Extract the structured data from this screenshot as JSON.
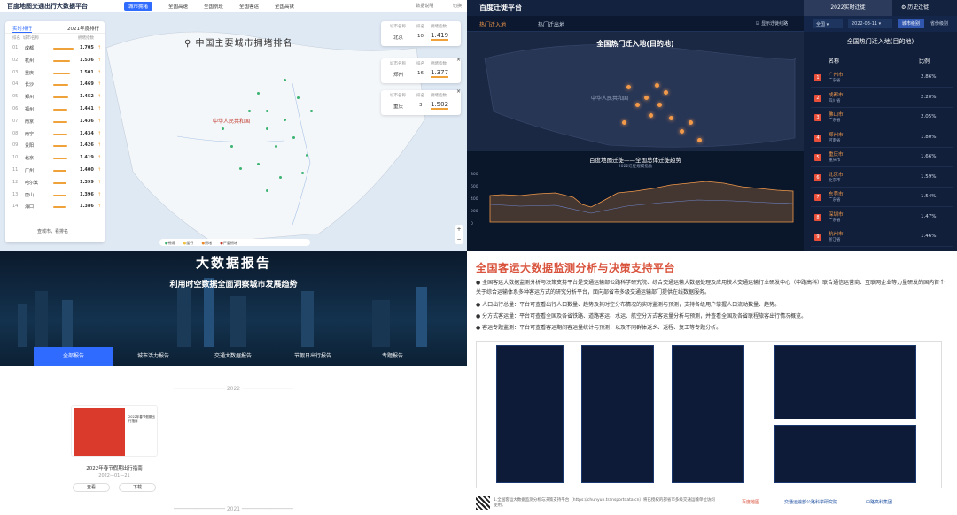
{
  "q1": {
    "logo": "百度地图交通出行大数据平台",
    "nav": [
      "城市拥堵",
      "全国高速",
      "全国航班",
      "全国客运",
      "全国高铁"
    ],
    "top_right": [
      "数据说明",
      "切换"
    ],
    "panel_tabs": [
      "实时排行",
      "2021年度排行"
    ],
    "panel_headers": [
      "排名",
      "城市名称",
      "拥堵指数"
    ],
    "rows": [
      {
        "rank": "01",
        "city": "成都",
        "value": "1.705",
        "pct": 0.95
      },
      {
        "rank": "02",
        "city": "杭州",
        "value": "1.536",
        "pct": 0.8
      },
      {
        "rank": "03",
        "city": "重庆",
        "value": "1.501",
        "pct": 0.77
      },
      {
        "rank": "04",
        "city": "长沙",
        "value": "1.469",
        "pct": 0.72
      },
      {
        "rank": "05",
        "city": "郑州",
        "value": "1.452",
        "pct": 0.7
      },
      {
        "rank": "06",
        "city": "福州",
        "value": "1.441",
        "pct": 0.68
      },
      {
        "rank": "07",
        "city": "南京",
        "value": "1.436",
        "pct": 0.67
      },
      {
        "rank": "08",
        "city": "南宁",
        "value": "1.434",
        "pct": 0.67
      },
      {
        "rank": "09",
        "city": "贵阳",
        "value": "1.426",
        "pct": 0.66
      },
      {
        "rank": "10",
        "city": "北京",
        "value": "1.419",
        "pct": 0.65
      },
      {
        "rank": "11",
        "city": "广州",
        "value": "1.400",
        "pct": 0.62
      },
      {
        "rank": "12",
        "city": "哈尔滨",
        "value": "1.399",
        "pct": 0.62
      },
      {
        "rank": "13",
        "city": "唐山",
        "value": "1.396",
        "pct": 0.61
      },
      {
        "rank": "14",
        "city": "海口",
        "value": "1.386",
        "pct": 0.6
      }
    ],
    "panel_footer": "查城市，看排名",
    "map_title": "中国主要城市拥堵排名",
    "map_label": "中华人民共和国",
    "compare": [
      {
        "h1": "城市名称",
        "h2": "排名",
        "h3": "拥堵指数",
        "city": "北京",
        "rank": "10",
        "value": "1.419"
      },
      {
        "h1": "城市名称",
        "h2": "排名",
        "h3": "拥堵指数",
        "city": "郑州",
        "rank": "16",
        "value": "1.377"
      },
      {
        "h1": "城市名称",
        "h2": "排名",
        "h3": "拥堵指数",
        "city": "重庆",
        "rank": "3",
        "value": "1.502"
      }
    ],
    "legend": [
      "畅通",
      "缓行",
      "拥堵",
      "严重拥堵"
    ]
  },
  "q2": {
    "logo": "百度迁徙平台",
    "tabs": [
      "热门迁入地",
      "热门迁出地"
    ],
    "checkbox": "显示迁徙线路",
    "header_btn": "2022实时迁徙",
    "history": "历史迁徙",
    "sel_region": "全国",
    "sel_date": "2022-03-11",
    "btn_city": "城市级别",
    "btn_prov": "省份级别",
    "map_title": "全国热门迁入地(目的地)",
    "map_label": "中华人民共和国",
    "chart_title": "百度地图迁徙——全国总体迁徙趋势",
    "chart_sub": "2022迁徙规模指数",
    "panel_title": "全国热门迁入地(目的地)",
    "col_name": "名称",
    "col_ratio": "比例",
    "rows": [
      {
        "n": "1",
        "city": "广州市",
        "prov": "广东省",
        "ratio": "2.86%"
      },
      {
        "n": "2",
        "city": "成都市",
        "prov": "四川省",
        "ratio": "2.20%"
      },
      {
        "n": "3",
        "city": "佛山市",
        "prov": "广东省",
        "ratio": "2.05%"
      },
      {
        "n": "4",
        "city": "郑州市",
        "prov": "河南省",
        "ratio": "1.80%"
      },
      {
        "n": "5",
        "city": "重庆市",
        "prov": "重庆市",
        "ratio": "1.66%"
      },
      {
        "n": "6",
        "city": "北京市",
        "prov": "北京市",
        "ratio": "1.59%"
      },
      {
        "n": "7",
        "city": "东莞市",
        "prov": "广东省",
        "ratio": "1.54%"
      },
      {
        "n": "8",
        "city": "深圳市",
        "prov": "广东省",
        "ratio": "1.47%"
      },
      {
        "n": "9",
        "city": "杭州市",
        "prov": "浙江省",
        "ratio": "1.46%"
      }
    ],
    "yticks": [
      "800",
      "600",
      "400",
      "200",
      "0"
    ]
  },
  "q3": {
    "title": "大数据报告",
    "subtitle": "利用时空数据全面洞察城市发展趋势",
    "cats": [
      "全部报告",
      "城市活力报告",
      "交通大数据报告",
      "节假日出行报告",
      "专题报告"
    ],
    "year1": "2022",
    "card_title": "2022年春节假期出行指南",
    "card_date": "2022—01—21",
    "btn_view": "查看",
    "btn_dl": "下载",
    "year2": "2021"
  },
  "q4": {
    "title": "全国客运大数据监测分析与决策支持平台",
    "bullets": [
      "全国客运大数据监测分析与决策支持平台是交通运输部公路科学研究院、综合交通运输大数据处理及应用技术交通运输行业研发中心（中路高科）联合通信运营商、互联网企业等力量研发的国内首个关于综合运输体系多种客运方式的研究分析平台，面向部省市多级交通运输部门提供在线数据服务。",
      "人口出行总量：平台可查看出行人口数量、趋势及其时空分布情况的实时监测与预测，支持各级用户掌握人口流动数量、趋势。",
      "分方式客运量：平台可查看全国及各省铁路、道路客运、水运、航空分方式客运量分析与预测，并查看全国及各省联程旅客出行情况概览。",
      "客运专题监测：平台可查看客运期间客运量统计与预测，以及不同群体返乡、返程、复工等专题分析。"
    ],
    "footer": "1.全国客运大数据监测分析与决策支持平台（https://chunyun.transportdata.cn）将已授权的部省市多级交通运输单位访问使用。",
    "logos": [
      "百度地图",
      "交通运输部公路科学研究院",
      "中路高科集团"
    ]
  }
}
